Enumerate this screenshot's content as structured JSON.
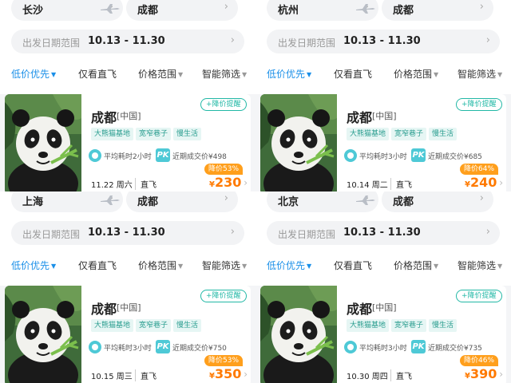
{
  "common": {
    "date_label": "出发日期范围",
    "chev": "›",
    "dest": "成都",
    "country": "[中国]",
    "remind": "+降价提醒",
    "tags": [
      "大熊猫基地",
      "宽窄巷子",
      "慢生活"
    ],
    "direct": "直飞",
    "currency": "¥",
    "filters": [
      "低价优先",
      "仅看直飞",
      "价格范围",
      "智能筛选"
    ],
    "caret": "▼",
    "pk": "PK",
    "colors": {
      "accent": "#1a8fe8",
      "price": "#ff7a00",
      "tag": "#2a9d8f",
      "discount_bg": "#ff9f1c"
    },
    "icons": {
      "plane": "plane-icon",
      "duration": "clock-icon",
      "pk": "pk-badge-icon",
      "photo": "panda-photo"
    }
  },
  "panels": [
    {
      "from": "长沙",
      "to": "成都",
      "date_range": "10.13 - 11.30",
      "duration": "平均耗时2小时",
      "recent_price": "近期成交价¥498",
      "date": "11.22 周六",
      "discount": "降价53%",
      "price": "230"
    },
    {
      "from": "杭州",
      "to": "成都",
      "date_range": "10.13 - 11.30",
      "duration": "平均耗时3小时",
      "recent_price": "近期成交价¥685",
      "date": "10.14 周二",
      "discount": "降价64%",
      "price": "240"
    },
    {
      "from": "上海",
      "to": "成都",
      "date_range": "10.13 - 11.30",
      "duration": "平均耗时3小时",
      "recent_price": "近期成交价¥750",
      "date": "10.15 周三",
      "discount": "降价53%",
      "price": "350"
    },
    {
      "from": "北京",
      "to": "成都",
      "date_range": "10.13 - 11.30",
      "duration": "平均耗时3小时",
      "recent_price": "近期成交价¥735",
      "date": "10.30 周四",
      "discount": "降价46%",
      "price": "390"
    }
  ]
}
